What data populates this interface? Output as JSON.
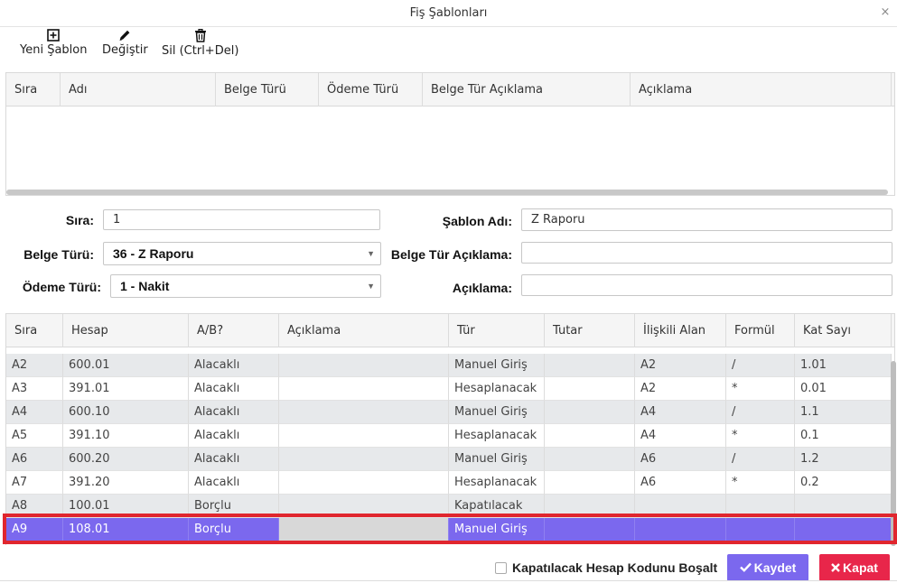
{
  "window": {
    "title": "Fiş Şablonları",
    "close_glyph": "×"
  },
  "toolbar": {
    "new_label": "Yeni Şablon",
    "edit_label": "Değiştir",
    "delete_label": "Sil (Ctrl+Del)",
    "new_icon": "plus-square-icon",
    "edit_icon": "pencil-icon",
    "delete_icon": "trash-icon"
  },
  "templates_grid": {
    "columns": [
      "Sıra",
      "Adı",
      "Belge Türü",
      "Ödeme Türü",
      "Belge Tür Açıklama",
      "Açıklama"
    ],
    "rows": []
  },
  "form": {
    "sira_label": "Sıra:",
    "sira_value": "1",
    "sablon_adi_label": "Şablon Adı:",
    "sablon_adi_value": "Z Raporu",
    "belge_turu_label": "Belge Türü:",
    "belge_turu_value": "36 - Z Raporu",
    "belge_tur_aciklama_label": "Belge Tür Açıklama:",
    "belge_tur_aciklama_value": "",
    "odeme_turu_label": "Ödeme Türü:",
    "odeme_turu_value": "1 - Nakit",
    "aciklama_label": "Açıklama:",
    "aciklama_value": "",
    "dropdown_caret": "▼"
  },
  "lines_grid": {
    "columns": [
      "Sıra",
      "Hesap",
      "A/B?",
      "Açıklama",
      "Tür",
      "Tutar",
      "İlişkili Alan",
      "Formül",
      "Kat Sayı"
    ],
    "rows": [
      [
        "A2",
        "600.01",
        "Alacaklı",
        "",
        "Manuel Giriş",
        "",
        "A2",
        "/",
        "1.01"
      ],
      [
        "A3",
        "391.01",
        "Alacaklı",
        "",
        "Hesaplanacak",
        "",
        "A2",
        "*",
        "0.01"
      ],
      [
        "A4",
        "600.10",
        "Alacaklı",
        "",
        "Manuel Giriş",
        "",
        "A4",
        "/",
        "1.1"
      ],
      [
        "A5",
        "391.10",
        "Alacaklı",
        "",
        "Hesaplanacak",
        "",
        "A4",
        "*",
        "0.1"
      ],
      [
        "A6",
        "600.20",
        "Alacaklı",
        "",
        "Manuel Giriş",
        "",
        "A6",
        "/",
        "1.2"
      ],
      [
        "A7",
        "391.20",
        "Alacaklı",
        "",
        "Hesaplanacak",
        "",
        "A6",
        "*",
        "0.2"
      ],
      [
        "A8",
        "100.01",
        "Borçlu",
        "",
        "Kapatılacak",
        "",
        "",
        "",
        ""
      ],
      [
        "A9",
        "108.01",
        "Borçlu",
        "",
        "Manuel Giriş",
        "",
        "",
        "",
        ""
      ]
    ],
    "selected_row": "A9"
  },
  "footer": {
    "checkbox_label": "Kapatılacak Hesap Kodunu Boşalt",
    "save_label": "Kaydet",
    "close_label": "Kapat",
    "save_icon": "check-icon",
    "close_icon": "x-icon"
  },
  "colors": {
    "accent": "#7b68ee",
    "danger": "#e8264a",
    "selection_outline": "#e0262e"
  }
}
